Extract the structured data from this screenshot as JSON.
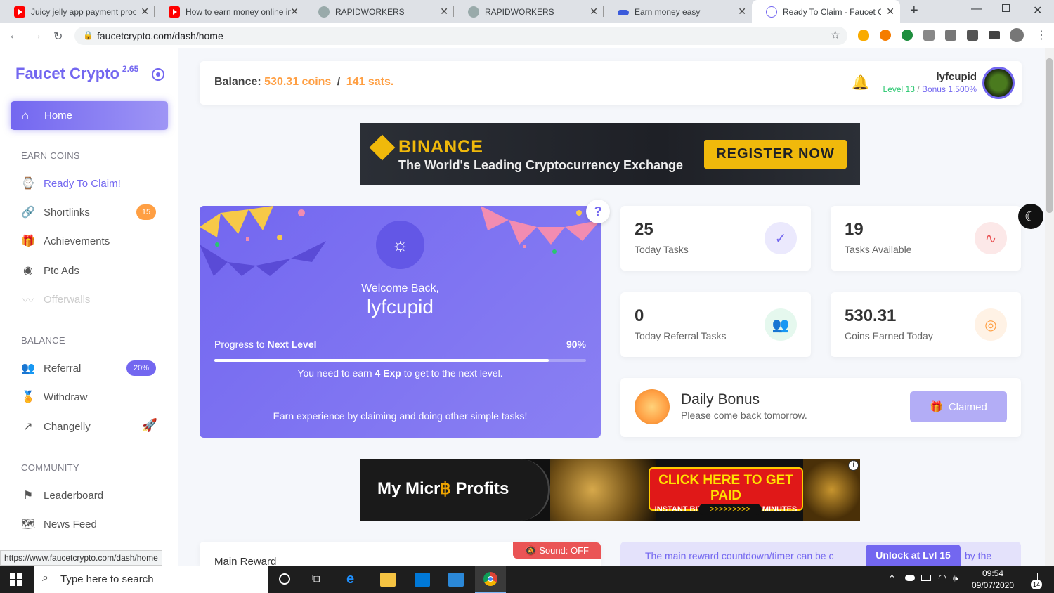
{
  "browser": {
    "tabs": [
      {
        "title": "Juicy jelly app payment proo"
      },
      {
        "title": "How to earn money online in"
      },
      {
        "title": "RAPIDWORKERS"
      },
      {
        "title": "RAPIDWORKERS"
      },
      {
        "title": "Earn money easy"
      },
      {
        "title": "Ready To Claim - Faucet Cryp"
      }
    ],
    "url": "faucetcrypto.com/dash/home",
    "status_url": "https://www.faucetcrypto.com/dash/home"
  },
  "sidebar": {
    "brand": "Faucet Crypto",
    "version": "2.65",
    "home": "Home",
    "sections": {
      "earn": "EARN COINS",
      "balance": "BALANCE",
      "community": "COMMUNITY"
    },
    "earn_items": [
      {
        "label": "Ready To Claim!",
        "icon": "watch-icon"
      },
      {
        "label": "Shortlinks",
        "icon": "link-icon",
        "badge": "15"
      },
      {
        "label": "Achievements",
        "icon": "gift-icon"
      },
      {
        "label": "Ptc Ads",
        "icon": "eye-icon"
      },
      {
        "label": "Offerwalls",
        "icon": "activity-icon"
      }
    ],
    "balance_items": [
      {
        "label": "Referral",
        "icon": "users-icon",
        "badge": "20%"
      },
      {
        "label": "Withdraw",
        "icon": "award-icon"
      },
      {
        "label": "Changelly",
        "icon": "external-link-icon"
      }
    ],
    "community_items": [
      {
        "label": "Leaderboard",
        "icon": "flag-icon"
      },
      {
        "label": "News Feed",
        "icon": "map-icon"
      }
    ]
  },
  "header": {
    "balance_label": "Balance:",
    "coins": "530.31 coins",
    "divider": "/",
    "sats": "141 sats.",
    "username": "lyfcupid",
    "level": "Level 13",
    "bonus": "Bonus 1.500%"
  },
  "binance_banner": {
    "brand": "BINANCE",
    "tagline": "The World's Leading Cryptocurrency Exchange",
    "cta": "REGISTER NOW"
  },
  "welcome": {
    "greeting": "Welcome Back,",
    "username": "lyfcupid",
    "progress_label": "Progress to",
    "progress_target": "Next Level",
    "progress_percent": "90%",
    "progress_value": 0.9,
    "need_prefix": "You need to earn",
    "need_amount": "4 Exp",
    "need_suffix": "to get to the next level.",
    "hint": "Earn experience by claiming and doing other simple tasks!",
    "help": "?"
  },
  "stats": [
    {
      "value": "25",
      "label": "Today Tasks",
      "icon": "check-icon",
      "color": "#7367f0",
      "bg": "#ebe9fd"
    },
    {
      "value": "19",
      "label": "Tasks Available",
      "icon": "activity-icon",
      "color": "#ea5455",
      "bg": "#fce8e8"
    },
    {
      "value": "0",
      "label": "Today Referral Tasks",
      "icon": "users-icon",
      "color": "#28c76f",
      "bg": "#e5f8ee"
    },
    {
      "value": "530.31",
      "label": "Coins Earned Today",
      "icon": "target-icon",
      "color": "#ff9f43",
      "bg": "#fff2e5"
    }
  ],
  "daily_bonus": {
    "title": "Daily Bonus",
    "subtitle": "Please come back tomorrow.",
    "button": "Claimed"
  },
  "micro_banner": {
    "brand_a": "My Micr",
    "brand_b": "Profits",
    "cta_title": "CLICK HERE TO GET PAID",
    "cta_sub": "INSTANT BITCOIN EVERY 60 MINUTES",
    "cta_arrows": ">>>>>>>>>"
  },
  "main_reward": {
    "title": "Main Reward",
    "sound": "Sound: OFF",
    "notice_a": "The main reward countdown/timer can be c",
    "notice_b": "by the",
    "unlock": "Unlock at Lvl 15"
  },
  "taskbar": {
    "search": "Type here to search",
    "time": "09:54",
    "date": "09/07/2020",
    "notif": "14"
  }
}
